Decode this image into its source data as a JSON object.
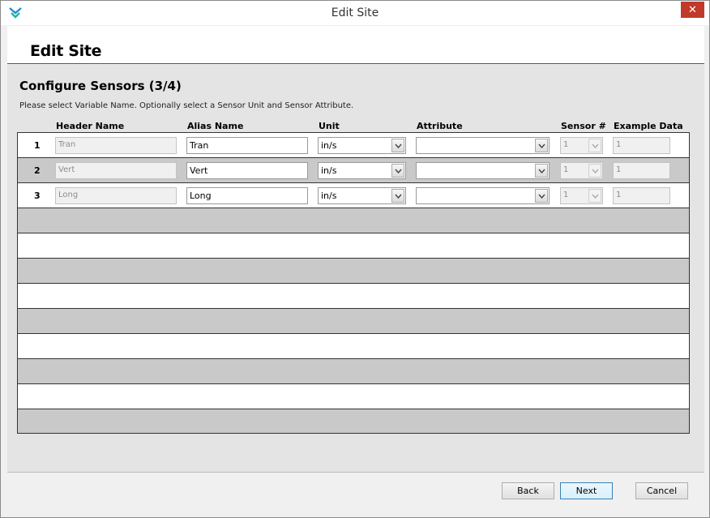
{
  "window": {
    "title": "Edit Site",
    "close_glyph": "✕"
  },
  "header": {
    "title": "Edit Site"
  },
  "section": {
    "title": "Configure Sensors (3/4)",
    "instructions": "Please select Variable Name. Optionally select a Sensor Unit and Sensor Attribute."
  },
  "columns": {
    "header_name": "Header Name",
    "alias_name": "Alias Name",
    "unit": "Unit",
    "attribute": "Attribute",
    "sensor_num": "Sensor #",
    "example_data": "Example Data"
  },
  "rows": [
    {
      "num": "1",
      "header_name": "Tran",
      "alias": "Tran",
      "unit": "in/s",
      "attribute": "",
      "sensor": "1",
      "example": "1"
    },
    {
      "num": "2",
      "header_name": "Vert",
      "alias": "Vert",
      "unit": "in/s",
      "attribute": "",
      "sensor": "1",
      "example": "1"
    },
    {
      "num": "3",
      "header_name": "Long",
      "alias": "Long",
      "unit": "in/s",
      "attribute": "",
      "sensor": "1",
      "example": "1"
    }
  ],
  "buttons": {
    "back": "Back",
    "next": "Next",
    "cancel": "Cancel"
  },
  "colors": {
    "accent": "#3c7fb1",
    "row_alt": "#c9c9c9",
    "panel": "#e4e4e4"
  },
  "icons": {
    "app": "app-logo-icon",
    "dropdown": "chevron-down-icon"
  }
}
